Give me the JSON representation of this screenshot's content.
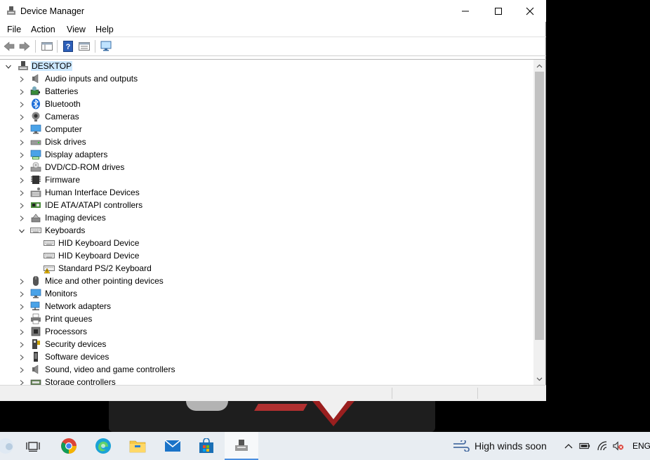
{
  "window": {
    "title": "Device Manager"
  },
  "menubar": {
    "items": [
      "File",
      "Action",
      "View",
      "Help"
    ]
  },
  "tree": {
    "root": "DESKTOP",
    "categories": [
      {
        "label": "Audio inputs and outputs",
        "icon": "speaker-icon"
      },
      {
        "label": "Batteries",
        "icon": "battery-icon"
      },
      {
        "label": "Bluetooth",
        "icon": "bluetooth-icon"
      },
      {
        "label": "Cameras",
        "icon": "camera-icon"
      },
      {
        "label": "Computer",
        "icon": "monitor-icon"
      },
      {
        "label": "Disk drives",
        "icon": "disk-drive-icon"
      },
      {
        "label": "Display adapters",
        "icon": "display-adapter-icon"
      },
      {
        "label": "DVD/CD-ROM drives",
        "icon": "dvd-drive-icon"
      },
      {
        "label": "Firmware",
        "icon": "chip-icon"
      },
      {
        "label": "Human Interface Devices",
        "icon": "hid-icon"
      },
      {
        "label": "IDE ATA/ATAPI controllers",
        "icon": "ide-controller-icon"
      },
      {
        "label": "Imaging devices",
        "icon": "imaging-device-icon"
      },
      {
        "label": "Keyboards",
        "icon": "keyboard-icon",
        "expanded": true,
        "children": [
          {
            "label": "HID Keyboard Device",
            "icon": "keyboard-icon"
          },
          {
            "label": "HID Keyboard Device",
            "icon": "keyboard-icon"
          },
          {
            "label": "Standard PS/2 Keyboard",
            "icon": "keyboard-warning-icon"
          }
        ]
      },
      {
        "label": "Mice and other pointing devices",
        "icon": "mouse-icon"
      },
      {
        "label": "Monitors",
        "icon": "monitor-icon"
      },
      {
        "label": "Network adapters",
        "icon": "network-adapter-icon"
      },
      {
        "label": "Print queues",
        "icon": "printer-icon"
      },
      {
        "label": "Processors",
        "icon": "processor-icon"
      },
      {
        "label": "Security devices",
        "icon": "security-device-icon"
      },
      {
        "label": "Software devices",
        "icon": "software-device-icon"
      },
      {
        "label": "Sound, video and game controllers",
        "icon": "speaker-icon"
      },
      {
        "label": "Storage controllers",
        "icon": "storage-controller-icon"
      }
    ]
  },
  "taskbar": {
    "weather": "High winds soon",
    "language": "ENG"
  },
  "colors": {
    "selection": "#cce8ff",
    "accent": "#0078d7"
  }
}
